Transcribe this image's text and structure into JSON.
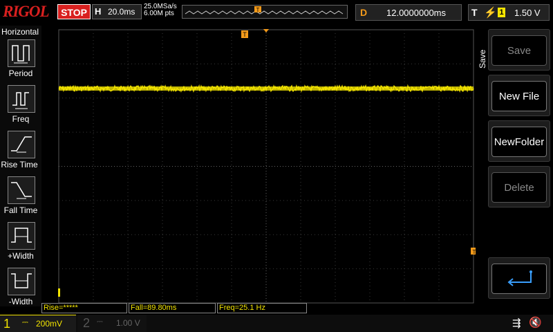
{
  "brand": "RIGOL",
  "status": "STOP",
  "horizontal": {
    "letter": "H",
    "timebase": "20.0ms",
    "sample_rate": "25.0MSa/s",
    "memory_depth": "6.00M pts"
  },
  "delay": {
    "letter": "D",
    "value": "12.0000000ms"
  },
  "trigger": {
    "letter": "T",
    "source": "1",
    "level": "1.50 V",
    "marker": "T"
  },
  "left_menu": {
    "title": "Horizontal",
    "items": [
      {
        "label": "Period",
        "icon": "period-icon"
      },
      {
        "label": "Freq",
        "icon": "freq-icon"
      },
      {
        "label": "Rise Time",
        "icon": "rise-time-icon"
      },
      {
        "label": "Fall Time",
        "icon": "fall-time-icon"
      },
      {
        "label": "+Width",
        "icon": "positive-width-icon"
      },
      {
        "label": "-Width",
        "icon": "negative-width-icon"
      }
    ]
  },
  "right_menu": {
    "title": "Save",
    "buttons": [
      {
        "label": "Save",
        "enabled": false
      },
      {
        "label": "New File",
        "enabled": true
      },
      {
        "label": "NewFolder",
        "enabled": true
      },
      {
        "label": "Delete",
        "enabled": false
      }
    ],
    "return_icon": "return-arrow-icon"
  },
  "measurements": {
    "rise": "Rise=*****",
    "fall": "Fall=89.80ms",
    "freq": "Freq=25.1 Hz"
  },
  "channels": [
    {
      "num": "1",
      "coupling": "⎓",
      "scale": "200mV",
      "color": "#f3e400",
      "active": true
    },
    {
      "num": "2",
      "coupling": "⎓",
      "scale": "1.00 V",
      "color": "#555555",
      "active": false
    }
  ],
  "colors": {
    "ch1": "#f3e400",
    "trigger": "#f39a1a",
    "stop": "#d8201f"
  },
  "status_icons": [
    "usb-icon",
    "mute-icon"
  ]
}
